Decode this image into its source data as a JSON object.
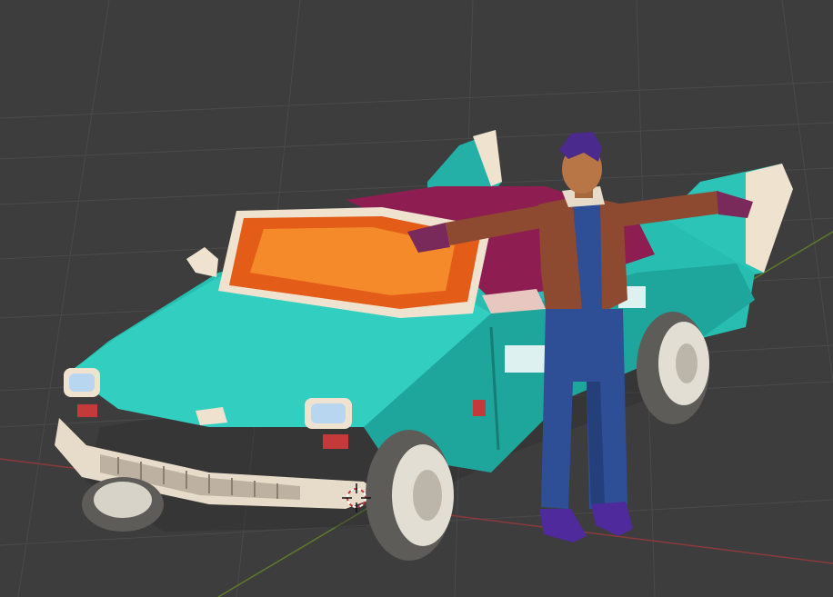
{
  "viewport": {
    "background_color": "#3d3d3d",
    "grid_color": "#4a4a4a",
    "x_axis_color": "#8a3a3a",
    "y_axis_color": "#5d7a2a"
  },
  "objects": [
    {
      "name": "taxi-car-model",
      "kind": "3d-model",
      "primary_color": "#27bdb1",
      "windshield_color": "#f07a22",
      "trim_color": "#efe3d0"
    },
    {
      "name": "character-model",
      "kind": "3d-model",
      "pose": "t-pose",
      "jacket_color": "#8d4a30",
      "pants_color": "#2e4f96",
      "hair_color": "#4a2a8c"
    }
  ],
  "cursor": {
    "name": "3d-cursor",
    "color": "#c43a3a"
  }
}
